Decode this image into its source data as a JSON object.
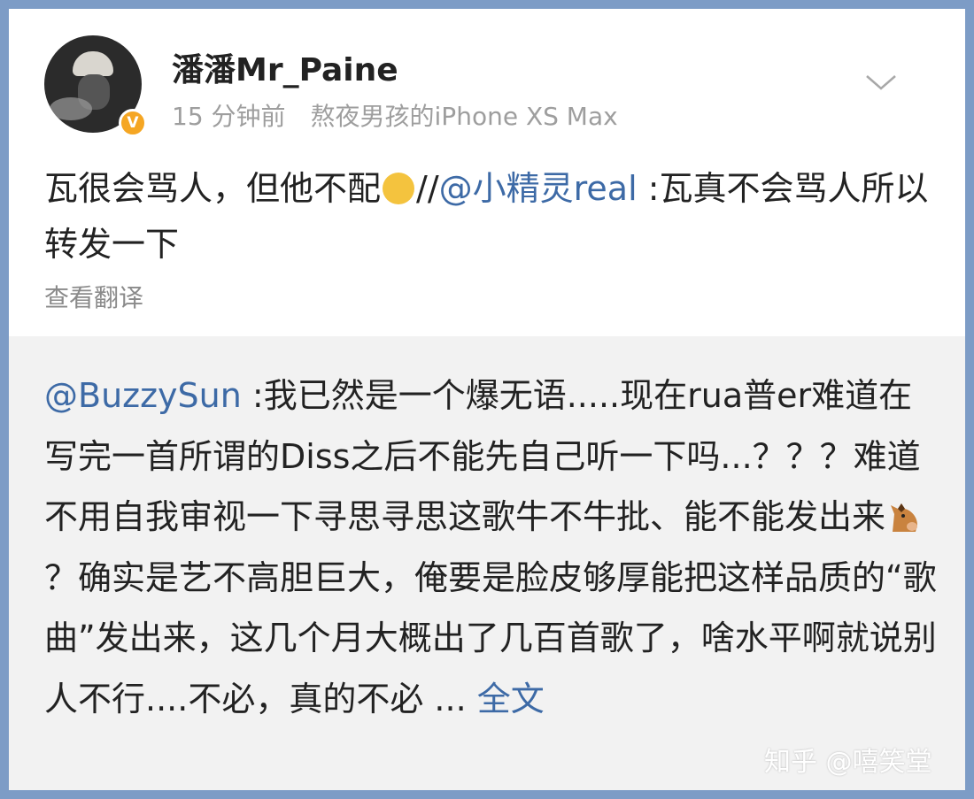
{
  "post": {
    "username": "潘潘Mr_Paine",
    "time": "15 分钟前",
    "source": "熬夜男孩的iPhone XS Max",
    "verified_badge": "V",
    "text_before": "瓦很会骂人，但他不配",
    "repost_sep": "//",
    "mention": "@小精灵real",
    "text_after": " :瓦真不会骂人所以转发一下",
    "translate": "查看翻译",
    "emoji": "smirk-face"
  },
  "quoted": {
    "mention": "@BuzzySun",
    "text1": " :我已然是一个爆无语.....现在rua普er难道在写完一首所谓的Diss之后不能先自己听一下吗...？？？难道不用自我审视一下寻思寻思这歌牛不牛批、能不能发出来",
    "emoji": "horse-face",
    "text2": "？确实是艺不高胆巨大，俺要是脸皮够厚能把这样品质的“歌曲”发出来，这几个月大概出了几百首歌了，啥水平啊就说别人不行....不必，真的不必 ",
    "ellipsis": "... ",
    "more": "全文"
  },
  "watermark": "知乎 @嘻笑堂",
  "colors": {
    "frame": "#7d9cc6",
    "link": "#3d6aa6",
    "quote_bg": "#f2f2f2",
    "meta": "#9e9e9e",
    "badge": "#f5a623"
  }
}
